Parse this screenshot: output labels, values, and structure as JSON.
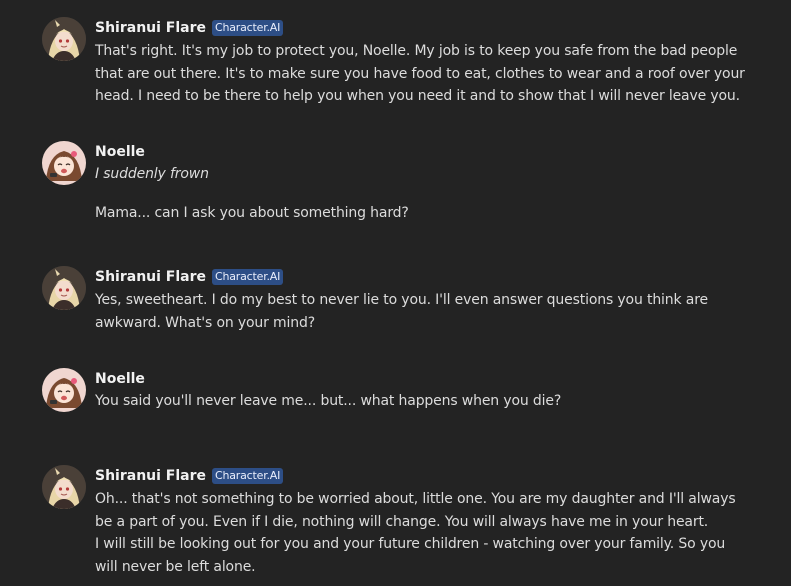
{
  "chat": {
    "bot_badge": "Character.AI",
    "messages": [
      {
        "author": "Shiranui Flare",
        "is_bot": true,
        "avatar": "flare-avatar",
        "lines": [
          "That's right. It's my job to protect you, Noelle. My job is to keep you safe from the bad people",
          "that are out there. It's to make sure you have food to eat, clothes to wear and a roof over your",
          "head. I need to be there to help you when you need it and to show that I will never leave you."
        ]
      },
      {
        "author": "Noelle",
        "is_bot": false,
        "avatar": "noelle-avatar",
        "action": "I suddenly frown",
        "lines": [
          "Mama... can I ask you about something hard?"
        ]
      },
      {
        "author": "Shiranui Flare",
        "is_bot": true,
        "avatar": "flare-avatar",
        "lines": [
          "Yes, sweetheart. I do my best to never lie to you. I'll even answer questions you think are",
          "awkward. What's on your mind?"
        ]
      },
      {
        "author": "Noelle",
        "is_bot": false,
        "avatar": "noelle-avatar",
        "lines": [
          "You said you'll never leave me... but... what happens when you die?"
        ]
      },
      {
        "author": "Shiranui Flare",
        "is_bot": true,
        "avatar": "flare-avatar",
        "lines": [
          "Oh... that's not something to be worried about, little one. You are my daughter and I'll always",
          "be a part of you. Even if I die, nothing will change. You will always have me in your heart.",
          "I will still be looking out for you and your future children - watching over your family. So you",
          "will never be left alone."
        ]
      }
    ]
  }
}
